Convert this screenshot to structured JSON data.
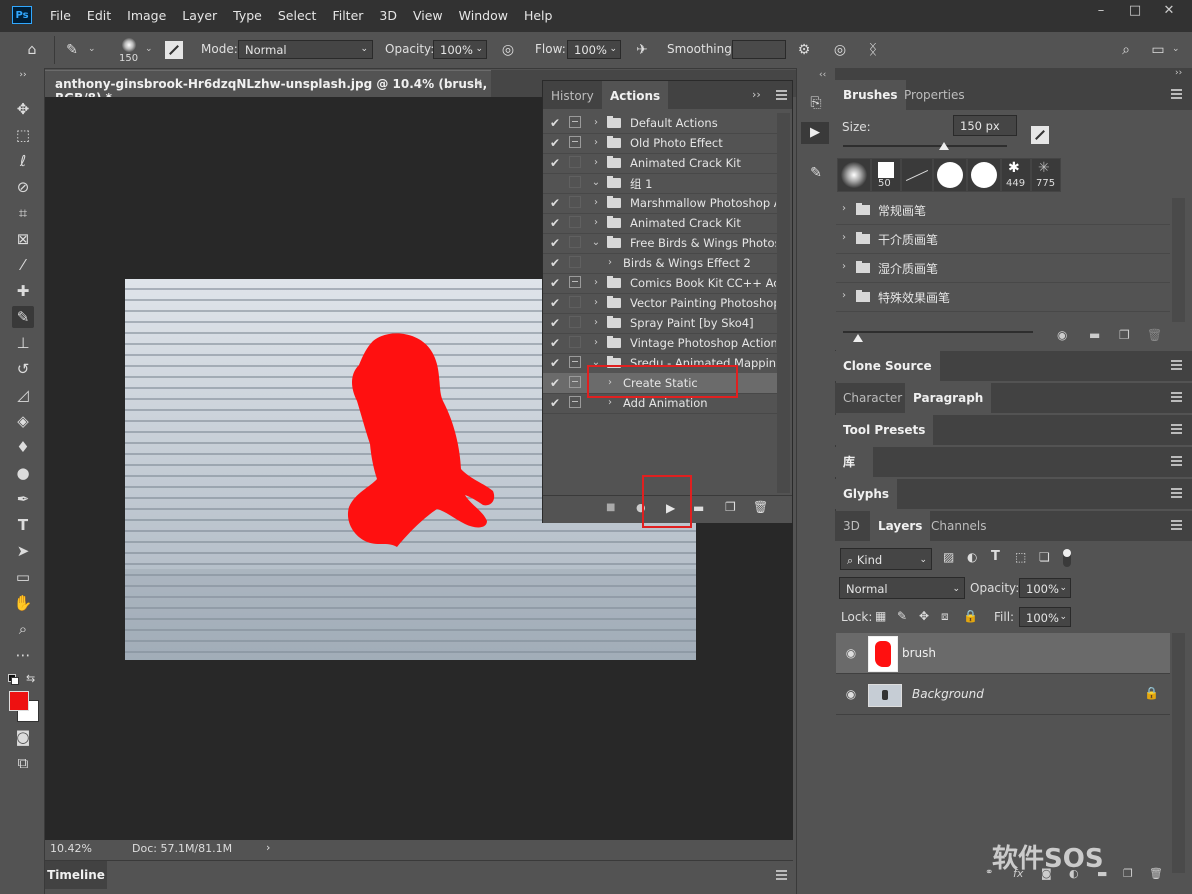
{
  "app": {
    "logo": "Ps",
    "menu": [
      "File",
      "Edit",
      "Image",
      "Layer",
      "Type",
      "Select",
      "Filter",
      "3D",
      "View",
      "Window",
      "Help"
    ],
    "window_buttons": [
      "–",
      "□",
      "✕"
    ]
  },
  "options_bar": {
    "brush_size": "150",
    "mode_label": "Mode:",
    "mode_value": "Normal",
    "opacity_label": "Opacity:",
    "opacity_value": "100%",
    "flow_label": "Flow:",
    "flow_value": "100%",
    "smoothing_label": "Smoothing:",
    "smoothing_value": ""
  },
  "document": {
    "tab_title": "anthony-ginsbrook-Hr6dzqNLzhw-unsplash.jpg @ 10.4% (brush, RGB/8) *",
    "close": "×",
    "zoom": "10.42%",
    "doc_info": "Doc: 57.1M/81.1M",
    "status_arrow": "›"
  },
  "timeline": {
    "tab": "Timeline"
  },
  "actions_panel": {
    "tabs": [
      "History",
      "Actions"
    ],
    "active_tab": "Actions",
    "expand": "››",
    "rows": [
      {
        "check": "✔",
        "dialog": true,
        "chev": "›",
        "folder": true,
        "label": "Default Actions",
        "indent": 0
      },
      {
        "check": "✔",
        "dialog": true,
        "chev": "›",
        "folder": true,
        "label": "Old Photo Effect",
        "indent": 0
      },
      {
        "check": "✔",
        "dialog": false,
        "chev": "›",
        "folder": true,
        "label": "Animated Crack Kit",
        "indent": 0
      },
      {
        "check": "",
        "dialog": false,
        "chev": "⌄",
        "folder": true,
        "label": "组 1",
        "indent": 0
      },
      {
        "check": "✔",
        "dialog": false,
        "chev": "›",
        "folder": true,
        "label": "Marshmallow Photoshop A...",
        "indent": 0
      },
      {
        "check": "✔",
        "dialog": false,
        "chev": "›",
        "folder": true,
        "label": "Animated Crack Kit",
        "indent": 0
      },
      {
        "check": "✔",
        "dialog": false,
        "chev": "⌄",
        "folder": true,
        "label": "Free Birds & Wings Photos...",
        "indent": 0
      },
      {
        "check": "✔",
        "dialog": false,
        "chev": "›",
        "folder": false,
        "label": "Birds & Wings Effect 2",
        "indent": 1
      },
      {
        "check": "✔",
        "dialog": true,
        "chev": "›",
        "folder": true,
        "label": "Comics Book Kit CC++ Act...",
        "indent": 0
      },
      {
        "check": "✔",
        "dialog": false,
        "chev": "›",
        "folder": true,
        "label": "Vector Painting Photoshop...",
        "indent": 0
      },
      {
        "check": "✔",
        "dialog": false,
        "chev": "›",
        "folder": true,
        "label": "Spray Paint [by Sko4]",
        "indent": 0
      },
      {
        "check": "✔",
        "dialog": false,
        "chev": "›",
        "folder": true,
        "label": "Vintage Photoshop Actions",
        "indent": 0
      },
      {
        "check": "✔",
        "dialog": true,
        "chev": "⌄",
        "folder": true,
        "label": "Sredu - Animated Mapping",
        "indent": 0
      },
      {
        "check": "✔",
        "dialog": true,
        "chev": "›",
        "folder": false,
        "label": "Create Static",
        "indent": 1,
        "selected": true
      },
      {
        "check": "✔",
        "dialog": true,
        "chev": "›",
        "folder": false,
        "label": "Add Animation",
        "indent": 1
      }
    ],
    "bottom_icons": [
      "stop-icon",
      "record-icon",
      "play-icon",
      "folder-icon",
      "new-icon",
      "trash-icon"
    ],
    "bottom_glyphs": [
      "■",
      "●",
      "▶",
      "▬",
      "❐",
      "🗑"
    ]
  },
  "brushes_panel": {
    "tabs": [
      "Brushes",
      "Properties"
    ],
    "size_label": "Size:",
    "size_value": "150 px",
    "presets": [
      "50",
      "",
      "",
      "",
      "",
      "449",
      "775"
    ],
    "folders": [
      "常规画笔",
      "干介质画笔",
      "湿介质画笔",
      "特殊效果画笔"
    ]
  },
  "panels": {
    "clone_source": "Clone Source",
    "character": "Character",
    "paragraph": "Paragraph",
    "tool_presets": "Tool Presets",
    "library": "库",
    "glyphs": "Glyphs"
  },
  "layers_panel": {
    "tabs": [
      "3D",
      "Layers",
      "Channels"
    ],
    "kind": "Kind",
    "blend_mode": "Normal",
    "opacity_label": "Opacity:",
    "opacity_value": "100%",
    "lock_label": "Lock:",
    "fill_label": "Fill:",
    "fill_value": "100%",
    "layers": [
      {
        "name": "brush",
        "italic": false,
        "selected": true
      },
      {
        "name": "Background",
        "italic": true,
        "selected": false
      }
    ]
  },
  "watermark": "软件SOS",
  "colors": {
    "foreground": "#ee1111",
    "background": "#ffffff",
    "highlight_box": "#e02020",
    "silhouette": "#ff1010"
  }
}
